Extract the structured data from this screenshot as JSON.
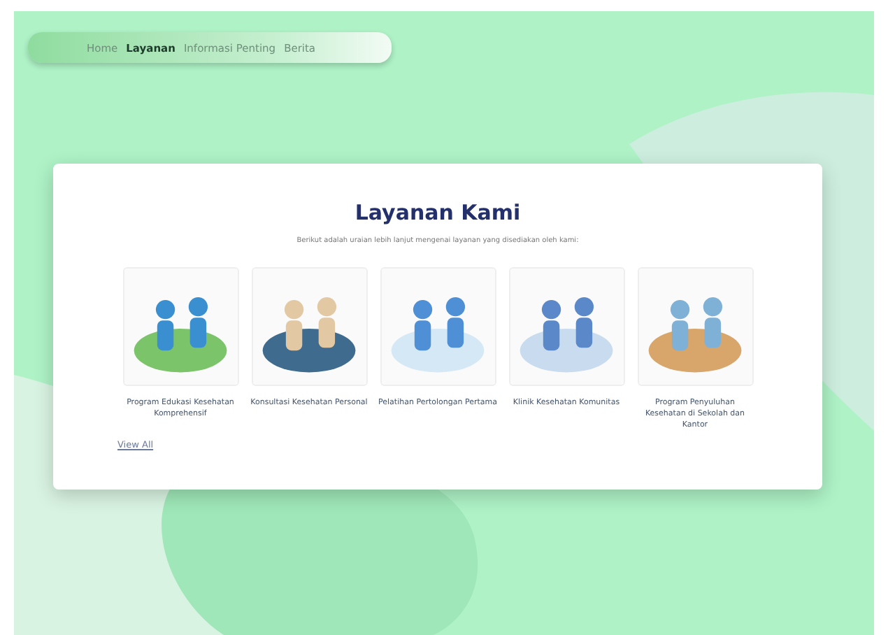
{
  "nav": {
    "items": [
      {
        "label": "Home",
        "selected": false
      },
      {
        "label": "Layanan",
        "selected": true
      },
      {
        "label": "Informasi Penting",
        "selected": false
      },
      {
        "label": "Berita",
        "selected": false
      }
    ]
  },
  "section": {
    "title": "Layanan Kami",
    "subtitle": "Berikut adalah uraian lebih lanjut mengenai layanan yang disediakan oleh kami:",
    "services": [
      {
        "caption": "Program Edukasi Kesehatan Komprehensif"
      },
      {
        "caption": "Konsultasi Kesehatan Personal"
      },
      {
        "caption": "Pelatihan Pertolongan Pertama"
      },
      {
        "caption": "Klinik Kesehatan Komunitas"
      },
      {
        "caption": "Program Penyuluhan Kesehatan di Sekolah dan Kantor"
      }
    ],
    "link": "View All"
  }
}
